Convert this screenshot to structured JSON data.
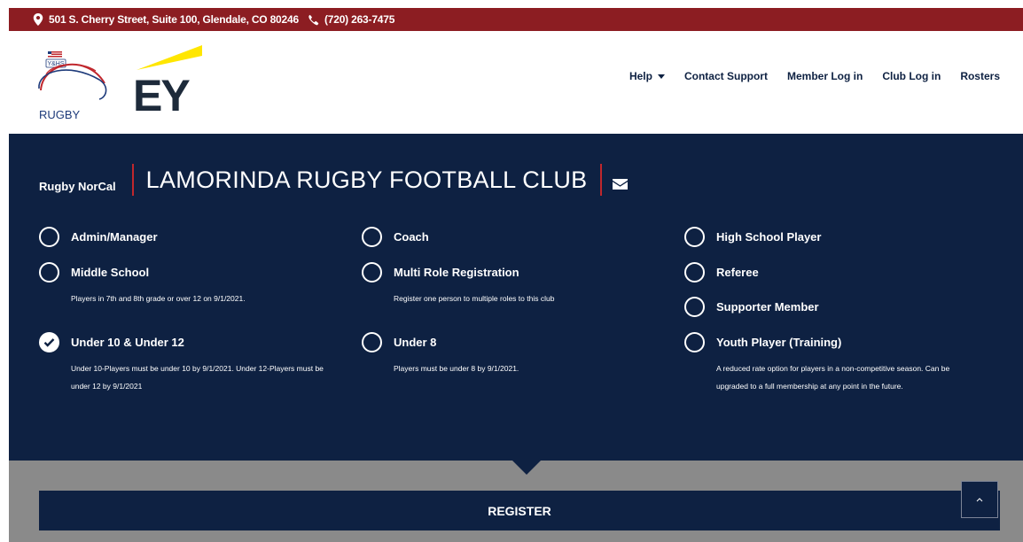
{
  "topbar": {
    "address": "501 S. Cherry Street, Suite 100, Glendale, CO 80246",
    "phone": "(720) 263-7475",
    "bg_color": "#8c1d22"
  },
  "header": {
    "logo_yhs_text": "Y&HS",
    "logo_rugby_text": "RUGBY",
    "logo_ey_text": "EY",
    "nav": [
      {
        "label": "Help"
      },
      {
        "label": "Contact Support"
      },
      {
        "label": "Member Log in"
      },
      {
        "label": "Club Log in"
      },
      {
        "label": "Rosters"
      }
    ]
  },
  "club": {
    "org": "Rugby NorCal",
    "name": "LAMORINDA RUGBY FOOTBALL CLUB",
    "panel_color": "#0e2142",
    "accent_color": "#c0272d"
  },
  "options": [
    {
      "label": "Admin/Manager",
      "desc": "",
      "checked": false
    },
    {
      "label": "Coach",
      "desc": "",
      "checked": false
    },
    {
      "label": "High School Player",
      "desc": "",
      "checked": false
    },
    {
      "label": "Middle School",
      "desc": "Players in 7th and 8th grade or over 12 on 9/1/2021.",
      "checked": false
    },
    {
      "label": "Multi Role Registration",
      "desc": "Register one person to multiple roles to this club",
      "checked": false
    },
    {
      "label": "Referee",
      "desc": "",
      "checked": false
    },
    {
      "label": "Supporter Member",
      "desc": "",
      "checked": false
    },
    {
      "label": "Under 10 & Under 12",
      "desc": "Under 10-Players must be under 10 by 9/1/2021. Under 12-Players must be under 12 by 9/1/2021",
      "checked": true
    },
    {
      "label": "Under 8",
      "desc": "Players must be under 8 by 9/1/2021.",
      "checked": false
    },
    {
      "label": "Youth Player (Training)",
      "desc": "A reduced rate option for players in a non-competitive season. Can be upgraded to a full membership at any point in the future.",
      "checked": false
    }
  ],
  "register_label": "REGISTER"
}
